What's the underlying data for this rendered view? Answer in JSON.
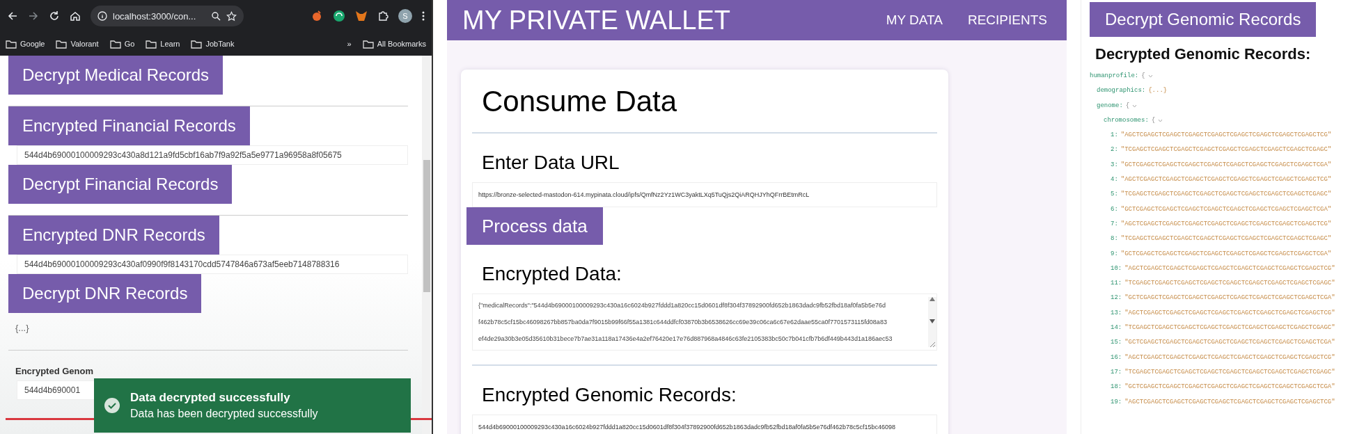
{
  "left_window": {
    "browser": {
      "address": "localhost:3000/con...",
      "profile_initial": "S",
      "bookmarks": [
        {
          "label": "Google"
        },
        {
          "label": "Valorant"
        },
        {
          "label": "Go"
        },
        {
          "label": "Learn"
        },
        {
          "label": "JobTank"
        }
      ],
      "overflow": "»",
      "all_bookmarks": "All Bookmarks"
    },
    "content": [
      {
        "kind": "button",
        "label": "Decrypt Medical Records"
      },
      {
        "kind": "divider"
      },
      {
        "kind": "button",
        "label": "Encrypted Financial Records"
      },
      {
        "kind": "field",
        "value": "544d4b69000100009293c430a8d121a9fd5cbf16ab7f9a92f5a5e9771a96958a8f05675"
      },
      {
        "kind": "button",
        "label": "Decrypt Financial Records"
      },
      {
        "kind": "divider"
      },
      {
        "kind": "button",
        "label": "Encrypted DNR Records"
      },
      {
        "kind": "field",
        "value": "544d4b69000100009293c430af0990f9f8143170cdd5747846a673af5eeb7148788316"
      },
      {
        "kind": "button",
        "label": "Decrypt DNR Records"
      },
      {
        "kind": "text",
        "text": "{...}"
      },
      {
        "kind": "divider"
      },
      {
        "kind": "label",
        "text": "Encrypted Genom"
      },
      {
        "kind": "field",
        "value": "544d4b690001"
      }
    ],
    "toast": {
      "title": "Data decrypted successfully",
      "message": "Data has been decrypted successfully"
    }
  },
  "wallet": {
    "title": "MY PRIVATE WALLET",
    "nav": [
      {
        "label": "MY DATA"
      },
      {
        "label": "RECIPIENTS"
      }
    ],
    "card": {
      "title": "Consume Data",
      "url_label": "Enter Data URL",
      "url_value": "https://bronze-selected-mastodon-614.mypinata.cloud/ipfs/QmfNz2Yz1WC3yaktLXq5TuQjs2QiARQHJYhQFrrBEtmRcL",
      "process_button": "Process data",
      "encrypted_label": "Encrypted Data:",
      "encrypted_lines": [
        "{\"medicalRecords\":\"544d4b69000100009293c430a16c6024b927fddd1a820cc15d0601df8f304f37892900fd652b1863dadc9fb52fbd18af0fa5b5e76d",
        "f462b78c5cf15bc46098267bb857ba0da7f9015b99f66f55a1381c644ddfcf03870b3b6538626cc69e39c06ca6c67e62daae55ca0f7701573115fd08a83",
        "ef4de29a30b3e05d35610b31bece7b7ae31a118a17436e4a2ef76420e17e76d887968a4846c63fe2105383bc50c7b041cfb7b6df449b443d1a186aec53"
      ],
      "genomic_label": "Encrypted Genomic Records:",
      "genomic_value": "544d4b69000100009293c430a16c6024b927fddd1a820cc15d0601df8f304f37892900fd652b1863dadc9fb52fbd18af0fa5b5e76df462b78c5cf15bc46098"
    }
  },
  "genomic": {
    "button": "Decrypt Genomic Records",
    "heading": "Decrypted Genomic Records:",
    "tree": [
      {
        "key": "humanprofile:",
        "value": "{",
        "expanded": true,
        "children": [
          {
            "key": "demographics:",
            "value": "{...}",
            "expanded": false
          },
          {
            "key": "genome:",
            "value": "{",
            "expanded": true,
            "children": [
              {
                "key": "chromosomes:",
                "value": "{",
                "expanded": true,
                "children": [
                  {
                    "key": "1:",
                    "value": "\"AGCTCGAGCTCGAGCTCGAGCTCGAGCTCGAGCTCGAGCTCGAGCTCGAGCTCG\""
                  },
                  {
                    "key": "2:",
                    "value": "\"TCGAGCTCGAGCTCGAGCTCGAGCTCGAGCTCGAGCTCGAGCTCGAGCTCGAGC\""
                  },
                  {
                    "key": "3:",
                    "value": "\"GCTCGAGCTCGAGCTCGAGCTCGAGCTCGAGCTCGAGCTCGAGCTCGAGCTCGA\""
                  },
                  {
                    "key": "4:",
                    "value": "\"AGCTCGAGCTCGAGCTCGAGCTCGAGCTCGAGCTCGAGCTCGAGCTCGAGCTCG\""
                  },
                  {
                    "key": "5:",
                    "value": "\"TCGAGCTCGAGCTCGAGCTCGAGCTCGAGCTCGAGCTCGAGCTCGAGCTCGAGC\""
                  },
                  {
                    "key": "6:",
                    "value": "\"GCTCGAGCTCGAGCTCGAGCTCGAGCTCGAGCTCGAGCTCGAGCTCGAGCTCGA\""
                  },
                  {
                    "key": "7:",
                    "value": "\"AGCTCGAGCTCGAGCTCGAGCTCGAGCTCGAGCTCGAGCTCGAGCTCGAGCTCG\""
                  },
                  {
                    "key": "8:",
                    "value": "\"TCGAGCTCGAGCTCGAGCTCGAGCTCGAGCTCGAGCTCGAGCTCGAGCTCGAGC\""
                  },
                  {
                    "key": "9:",
                    "value": "\"GCTCGAGCTCGAGCTCGAGCTCGAGCTCGAGCTCGAGCTCGAGCTCGAGCTCGA\""
                  },
                  {
                    "key": "10:",
                    "value": "\"AGCTCGAGCTCGAGCTCGAGCTCGAGCTCGAGCTCGAGCTCGAGCTCGAGCTCG\""
                  },
                  {
                    "key": "11:",
                    "value": "\"TCGAGCTCGAGCTCGAGCTCGAGCTCGAGCTCGAGCTCGAGCTCGAGCTCGAGC\""
                  },
                  {
                    "key": "12:",
                    "value": "\"GCTCGAGCTCGAGCTCGAGCTCGAGCTCGAGCTCGAGCTCGAGCTCGAGCTCGA\""
                  },
                  {
                    "key": "13:",
                    "value": "\"AGCTCGAGCTCGAGCTCGAGCTCGAGCTCGAGCTCGAGCTCGAGCTCGAGCTCG\""
                  },
                  {
                    "key": "14:",
                    "value": "\"TCGAGCTCGAGCTCGAGCTCGAGCTCGAGCTCGAGCTCGAGCTCGAGCTCGAGC\""
                  },
                  {
                    "key": "15:",
                    "value": "\"GCTCGAGCTCGAGCTCGAGCTCGAGCTCGAGCTCGAGCTCGAGCTCGAGCTCGA\""
                  },
                  {
                    "key": "16:",
                    "value": "\"AGCTCGAGCTCGAGCTCGAGCTCGAGCTCGAGCTCGAGCTCGAGCTCGAGCTCG\""
                  },
                  {
                    "key": "17:",
                    "value": "\"TCGAGCTCGAGCTCGAGCTCGAGCTCGAGCTCGAGCTCGAGCTCGAGCTCGAGC\""
                  },
                  {
                    "key": "18:",
                    "value": "\"GCTCGAGCTCGAGCTCGAGCTCGAGCTCGAGCTCGAGCTCGAGCTCGAGCTCGA\""
                  },
                  {
                    "key": "19:",
                    "value": "\"AGCTCGAGCTCGAGCTCGAGCTCGAGCTCGAGCTCGAGCTCGAGCTCGAGCTCG\""
                  }
                ]
              }
            ]
          }
        ]
      }
    ]
  }
}
